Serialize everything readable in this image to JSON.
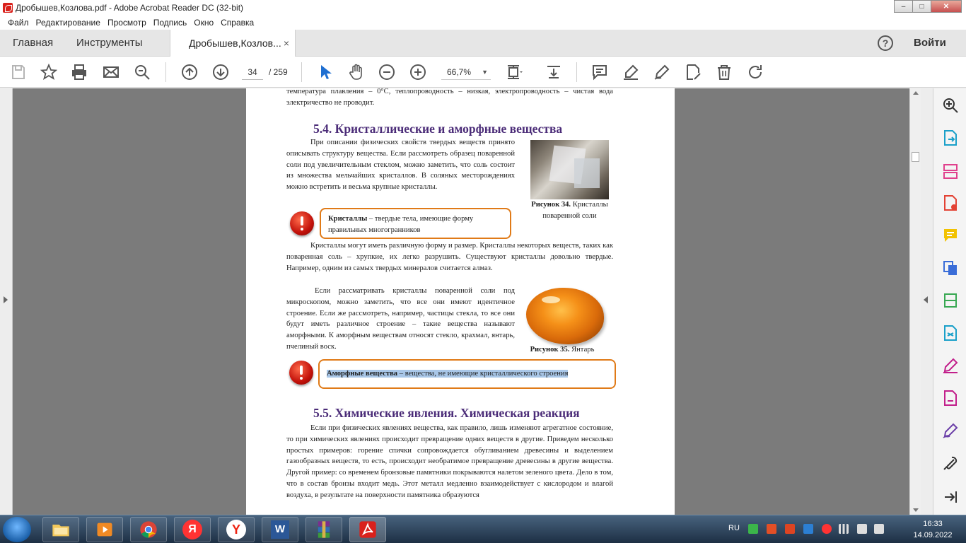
{
  "window": {
    "title": "Дробышев,Козлова.pdf - Adobe Acrobat Reader DC (32-bit)",
    "minimize_glyph": "–",
    "maximize_glyph": "□",
    "close_glyph": "✕"
  },
  "menu": [
    "Файл",
    "Редактирование",
    "Просмотр",
    "Подпись",
    "Окно",
    "Справка"
  ],
  "tabs": {
    "home": "Главная",
    "tools": "Инструменты",
    "document": "Дробышев,Козлов...",
    "close_glyph": "×",
    "help_glyph": "?",
    "sign_in": "Войти"
  },
  "toolbar": {
    "page_current": "34",
    "page_total": "/  259",
    "zoom": "66,7%",
    "zoom_dropdown_glyph": "▼",
    "icons": [
      "save-icon",
      "bookmark-star-icon",
      "print-icon",
      "email-icon",
      "search-zoom-icon",
      "page-up-icon",
      "page-down-icon",
      "select-cursor-icon",
      "hand-icon",
      "zoom-out-icon",
      "zoom-in-icon",
      "page-fit-icon",
      "scroll-mode-icon",
      "comment-icon",
      "highlight-icon",
      "sign-icon",
      "fill-sign-icon",
      "delete-icon",
      "rotate-icon"
    ]
  },
  "page": {
    "top_text": "температура плавления – 0°С, теплопроводность – низкая, электропроводность – чистая вода электричество не проводит.",
    "heading1": "5.4. Кристаллические и аморфные вещества",
    "para1": "При описании физических свойств твердых веществ принято описывать структуру вещества. Если рассмотреть образец поваренной соли под увеличительным стеклом, можно заметить, что соль состоит из множества мельчайших кристаллов. В соляных месторождениях можно встретить и весьма крупные кристаллы.",
    "figure34_caption_bold": "Рисунок 34.",
    "figure34_caption_rest": " Кристаллы поваренной соли",
    "callout1_bold": "Кристаллы",
    "callout1_rest": " – твердые тела, имеющие форму правильных многогранников",
    "para2": "Кристаллы могут иметь различную форму и размер. Кристаллы некоторых веществ, таких как поваренная соль – хрупкие, их легко разрушить. Существуют кристаллы довольно твердые. Например, одним из самых твердых минералов считается алмаз.",
    "para3": "Если рассматривать кристаллы поваренной соли под микроскопом, можно заметить, что все они имеют идентичное строение. Если же рассмотреть, например, частицы стекла, то все они будут иметь различное строение – такие вещества называют аморфными. К аморфным веществам относят стекло, крахмал, янтарь, пчелиный воск.",
    "figure35_caption_bold": "Рисунок 35.",
    "figure35_caption_rest": " Янтарь",
    "callout2_bold": "Аморфные вещества",
    "callout2_rest": " – вещества, не имеющие кристаллического строения",
    "heading2": "5.5. Химические явления. Химическая реакция",
    "para4": "Если при физических явлениях вещества, как правило, лишь изменяют агрегатное состояние, то при химических явлениях происходит превращение одних веществ в другие. Приведем несколько простых примеров: горение спички сопровождается обугливанием древесины и выделением газообразных веществ, то есть, происходит необратимое превращение древесины в другие вещества. Другой пример: со временем бронзовые памятники покрываются налетом зеленого цвета. Дело в том, что в состав бронзы входит медь. Этот металл медленно взаимодействует с кислородом и влагой воздуха, в результате на поверхности памятника образуются"
  },
  "right_tools": [
    "enhance-scan-icon",
    "export-pdf-icon",
    "organize-pages-icon",
    "create-pdf-icon",
    "comment-tool-icon",
    "combine-files-icon",
    "compress-icon",
    "send-review-icon",
    "fill-sign-tool-icon",
    "protect-icon",
    "sign-tool-icon",
    "more-tools-icon",
    "collapse-panel-icon"
  ],
  "taskbar": {
    "apps": [
      "explorer",
      "media-player",
      "chrome",
      "yandex-browser",
      "yandex",
      "word",
      "winrar",
      "acrobat"
    ],
    "yandex_letter": "Я",
    "yandex_y": "Y",
    "word_letter": "W",
    "language": "RU",
    "time": "16:33",
    "date": "14.09.2022"
  },
  "colors": {
    "heading": "#4b2c78",
    "callout_border": "#e07a17",
    "selection": "#a9c7e8",
    "acrobat_red": "#d9211c"
  }
}
